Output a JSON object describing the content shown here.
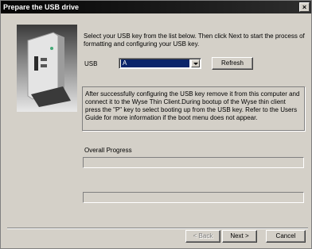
{
  "window": {
    "title": "Prepare the USB drive",
    "close_glyph": "×"
  },
  "intro": {
    "text": "Select your USB key from the list below. Then click Next to start the process of formatting and configuring your USB key."
  },
  "usb": {
    "label": "USB",
    "selected_value": "A",
    "refresh_label": "Refresh"
  },
  "info": {
    "text": "After successfully configuring the USB key remove it from this computer and connect it to the Wyse Thin Client.During bootup of the Wyse thin client press the \"P\" key to select booting up from the USB key. Refer to the Users Guide for more information if the boot menu does not appear."
  },
  "progress": {
    "label": "Overall Progress",
    "overall_value": 0,
    "current_value": 0
  },
  "buttons": {
    "back_label": "< Back",
    "next_label": "Next >",
    "cancel_label": "Cancel"
  },
  "colors": {
    "face": "#d4d0c8",
    "selection": "#0a246a",
    "titlebar": "#050505"
  },
  "icons": {
    "device_image": "wyse-thin-client-device"
  }
}
